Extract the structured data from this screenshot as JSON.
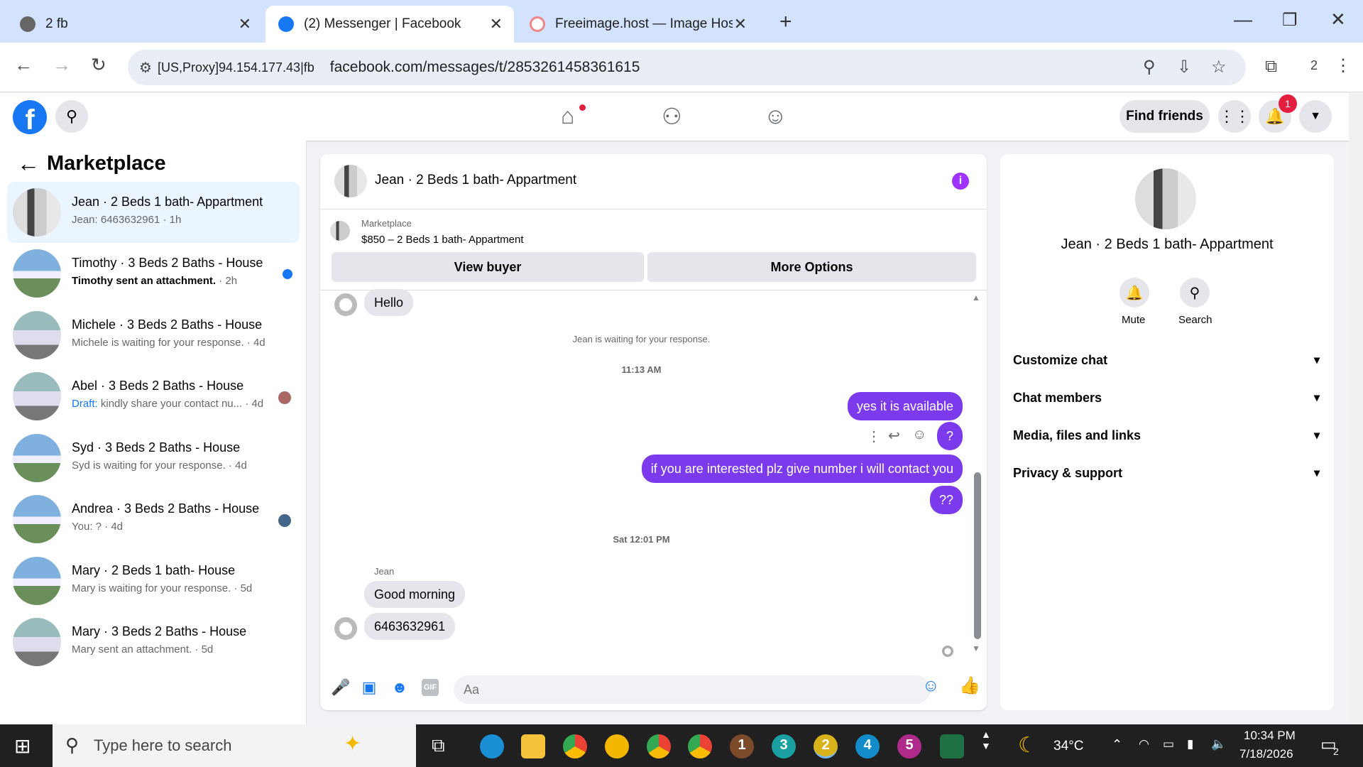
{
  "browser": {
    "tabs": [
      {
        "title": "2 fb",
        "icon": "globe-icon"
      },
      {
        "title": "(2) Messenger | Facebook",
        "icon": "facebook-icon"
      },
      {
        "title": "Freeimage.host — Image Hosti",
        "icon": "freeimage-icon"
      }
    ],
    "new_tab": "+",
    "proxy_label": "[US,Proxy]94.154.177.43|fb",
    "url": "facebook.com/messages/t/2853261458361615",
    "profile_count": "2"
  },
  "fb": {
    "find_friends": "Find friends",
    "notification_count": "1"
  },
  "left": {
    "title": "Marketplace",
    "conversations": [
      {
        "name": "Jean · 2 Beds 1 bath- Appartment",
        "sub": "Jean: 6463632961 · 1h"
      },
      {
        "name": "Timothy · 3 Beds 2 Baths - House",
        "sub": "Timothy sent an attachment.",
        "time": " · 2h"
      },
      {
        "name": "Michele · 3 Beds 2 Baths - House",
        "sub": "Michele is waiting for your response. · 4d"
      },
      {
        "name": "Abel · 3 Beds 2 Baths - House",
        "draft": "Draft:",
        "sub": " kindly share your contact nu... · 4d"
      },
      {
        "name": "Syd · 3 Beds 2 Baths - House",
        "sub": "Syd is waiting for your response. · 4d"
      },
      {
        "name": "Andrea · 3 Beds 2 Baths - House",
        "sub": "You: ? · 4d"
      },
      {
        "name": "Mary · 2 Beds 1 bath- House",
        "sub": "Mary is waiting for your response. · 5d"
      },
      {
        "name": "Mary · 3 Beds 2 Baths - House",
        "sub": "Mary sent an attachment. · 5d"
      }
    ]
  },
  "chat": {
    "title": "Jean · 2 Beds 1 bath- Appartment",
    "marketplace_label": "Marketplace",
    "listing": "$850 – 2 Beds 1 bath- Appartment",
    "view_buyer": "View buyer",
    "more_options": "More Options",
    "messages": {
      "hello": "Hello",
      "waiting_note": "Jean is waiting for your response.",
      "time1": "11:13 AM",
      "out1": "yes it is available",
      "out2": "?",
      "out3": "if you are interested plz give number i will contact you",
      "out4": "??",
      "time2": "Sat 12:01 PM",
      "sender": "Jean",
      "in1": "Good morning",
      "in2": "6463632961"
    },
    "input_placeholder": "Aa"
  },
  "right": {
    "name": "Jean · 2 Beds 1 bath- Appartment",
    "mute": "Mute",
    "search": "Search",
    "rows": [
      "Customize chat",
      "Chat members",
      "Media, files and links",
      "Privacy & support"
    ]
  },
  "taskbar": {
    "search_placeholder": "Type here to search",
    "temperature": "34°C",
    "time": "10:34 PM",
    "date": "7/18/2026",
    "notif_count": "2",
    "app_numbers": [
      "1",
      "3",
      "2",
      "4",
      "5"
    ]
  }
}
